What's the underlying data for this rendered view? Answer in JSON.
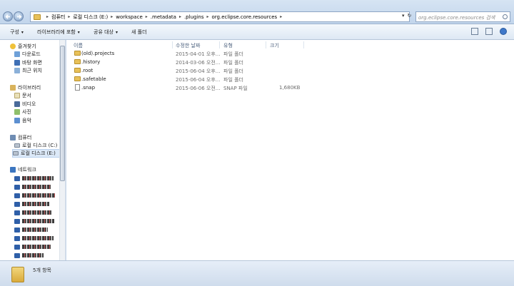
{
  "address": {
    "crumbs": [
      "컴퓨터",
      "로컬 디스크 (E:)",
      "workspace",
      ".metadata",
      ".plugins",
      "org.eclipse.core.resources"
    ],
    "separator": "▸"
  },
  "search": {
    "placeholder": "org.eclipse.core.resources 검색"
  },
  "toolbar": {
    "organize": "구성",
    "include_library": "라이브러리에 포함",
    "share": "공유 대상",
    "new_folder": "새 폴더"
  },
  "nav": {
    "favorites": "즐겨찾기",
    "downloads": "다운로드",
    "desktop": "바탕 화면",
    "recent": "최근 위치",
    "libraries": "라이브러리",
    "documents": "문서",
    "videos": "비디오",
    "pictures": "사진",
    "music": "음악",
    "computer": "컴퓨터",
    "drive_c": "로컬 디스크 (C:)",
    "drive_e": "로컬 디스크 (E:)",
    "network": "네트워크"
  },
  "columns": {
    "name": "이름",
    "modified": "수정한 날짜",
    "type": "유형",
    "size": "크기"
  },
  "files": [
    {
      "name": "(old).projects",
      "modified": "2015-04-01 오후...",
      "type": "파일 폴더",
      "size": "",
      "kind": "folder"
    },
    {
      "name": ".history",
      "modified": "2014-03-06 오전...",
      "type": "파일 폴더",
      "size": "",
      "kind": "folder"
    },
    {
      "name": ".root",
      "modified": "2015-06-04 오후...",
      "type": "파일 폴더",
      "size": "",
      "kind": "folder"
    },
    {
      "name": ".safetable",
      "modified": "2015-06-04 오후...",
      "type": "파일 폴더",
      "size": "",
      "kind": "folder"
    },
    {
      "name": ".snap",
      "modified": "2015-06-06 오전...",
      "type": "SNAP 파일",
      "size": "1,680KB",
      "kind": "file"
    }
  ],
  "status": {
    "item_count": "5개 항목"
  }
}
